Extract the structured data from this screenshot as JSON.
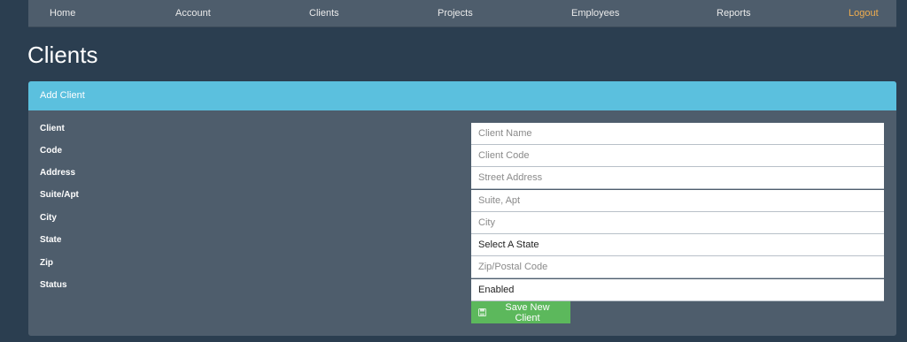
{
  "nav": {
    "items": [
      {
        "label": "Home",
        "name": "nav-home"
      },
      {
        "label": "Account",
        "name": "nav-account"
      },
      {
        "label": "Clients",
        "name": "nav-clients"
      },
      {
        "label": "Projects",
        "name": "nav-projects"
      },
      {
        "label": "Employees",
        "name": "nav-employees"
      },
      {
        "label": "Reports",
        "name": "nav-reports"
      },
      {
        "label": "Logout",
        "name": "nav-logout"
      }
    ]
  },
  "page": {
    "title": "Clients"
  },
  "panel": {
    "heading": "Add Client",
    "fields": [
      {
        "label": "Client",
        "placeholder": "Client Name"
      },
      {
        "label": "Code",
        "placeholder": "Client Code"
      },
      {
        "label": "Address",
        "placeholder": "Street Address"
      },
      {
        "label": "Suite/Apt",
        "placeholder": "Suite, Apt"
      },
      {
        "label": "City",
        "placeholder": "City"
      },
      {
        "label": "State",
        "value": "Select A State"
      },
      {
        "label": "Zip",
        "placeholder": "Zip/Postal Code"
      },
      {
        "label": "Status",
        "value": "Enabled"
      }
    ],
    "save_label": "Save New Client",
    "save_icon": "floppy-disk-icon"
  },
  "colors": {
    "background": "#2b3e50",
    "navbar": "#4e5d6c",
    "panel_heading": "#5bc0de",
    "save_button": "#5cb85c",
    "logout": "#f0ad4e"
  }
}
